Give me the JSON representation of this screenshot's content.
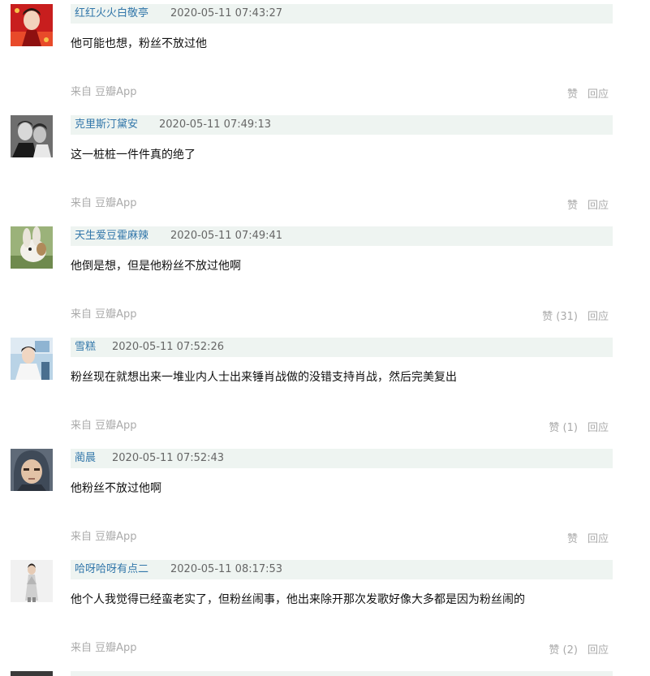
{
  "comments": [
    {
      "author": "红红火火白敬亭",
      "time": "2020-05-11 07:43:27",
      "text": "他可能也想，粉丝不放过他",
      "source": "来自 豆瓣App",
      "like_label": "赞",
      "reply_label": "回应"
    },
    {
      "author": "克里斯汀黛安",
      "time": "2020-05-11 07:49:13",
      "text": "这一桩桩一件件真的绝了",
      "source": "来自 豆瓣App",
      "like_label": "赞",
      "reply_label": "回应"
    },
    {
      "author": "天生爱豆霍麻辣",
      "time": "2020-05-11 07:49:41",
      "text": "他倒是想，但是他粉丝不放过他啊",
      "source": "来自 豆瓣App",
      "like_label": "赞 (31)",
      "reply_label": "回应"
    },
    {
      "author": "雪糕",
      "time": "2020-05-11 07:52:26",
      "text": "粉丝现在就想出来一堆业内人士出来锤肖战做的没错支持肖战，然后完美复出",
      "source": "来自 豆瓣App",
      "like_label": "赞 (1)",
      "reply_label": "回应"
    },
    {
      "author": "蔺晨",
      "time": "2020-05-11 07:52:43",
      "text": "他粉丝不放过他啊",
      "source": "来自 豆瓣App",
      "like_label": "赞",
      "reply_label": "回应"
    },
    {
      "author": "哈呀哈呀有点二",
      "time": "2020-05-11 08:17:53",
      "text": "他个人我觉得已经蛮老实了，但粉丝闹事，他出来除开那次发歌好像大多都是因为粉丝闹的",
      "source": "来自 豆瓣App",
      "like_label": "赞 (2)",
      "reply_label": "回应"
    }
  ]
}
